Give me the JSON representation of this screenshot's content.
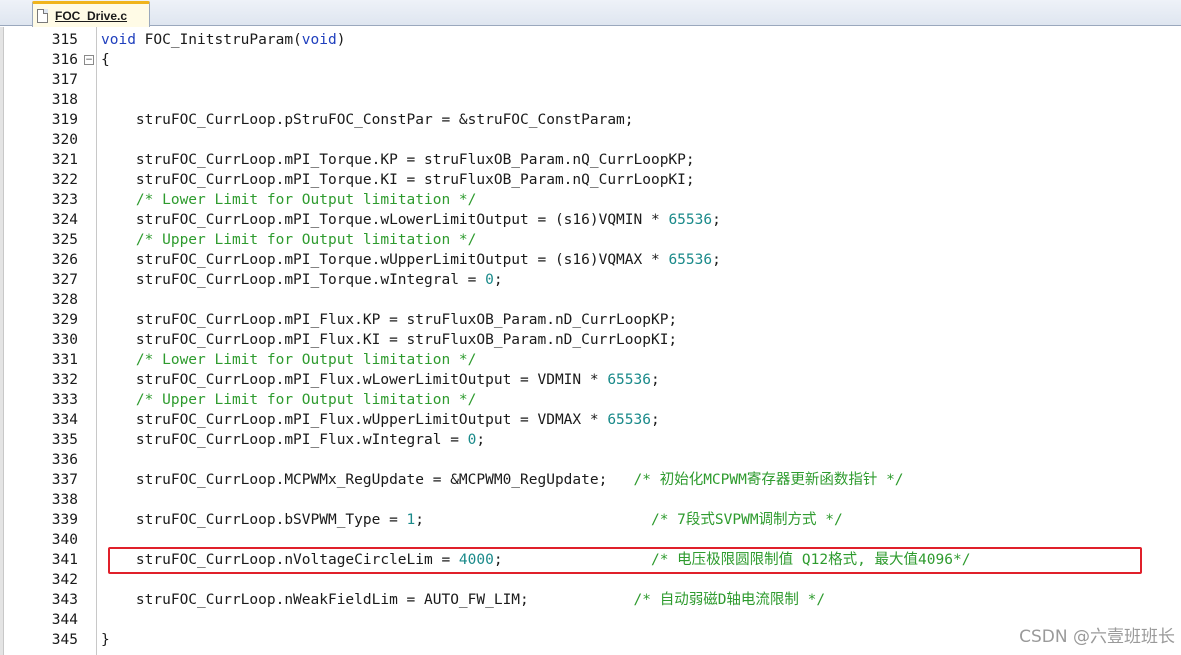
{
  "tab": {
    "label": "FOC_Drive.c",
    "icon": "file-icon"
  },
  "lines": [
    {
      "num": "315",
      "tokens": [
        {
          "t": "void",
          "c": "kw"
        },
        {
          "t": " FOC_InitstruParam("
        },
        {
          "t": "void",
          "c": "kw"
        },
        {
          "t": ")"
        }
      ]
    },
    {
      "num": "316",
      "fold": "−",
      "tokens": [
        {
          "t": "{"
        }
      ]
    },
    {
      "num": "317",
      "tokens": []
    },
    {
      "num": "318",
      "tokens": []
    },
    {
      "num": "319",
      "tokens": [
        {
          "t": "    struFOC_CurrLoop.pStruFOC_ConstPar = &struFOC_ConstParam;"
        }
      ]
    },
    {
      "num": "320",
      "tokens": []
    },
    {
      "num": "321",
      "tokens": [
        {
          "t": "    struFOC_CurrLoop.mPI_Torque.KP = struFluxOB_Param.nQ_CurrLoopKP;"
        }
      ]
    },
    {
      "num": "322",
      "tokens": [
        {
          "t": "    struFOC_CurrLoop.mPI_Torque.KI = struFluxOB_Param.nQ_CurrLoopKI;"
        }
      ]
    },
    {
      "num": "323",
      "tokens": [
        {
          "t": "    "
        },
        {
          "t": "/* Lower Limit for Output limitation */",
          "c": "cm"
        }
      ]
    },
    {
      "num": "324",
      "tokens": [
        {
          "t": "    struFOC_CurrLoop.mPI_Torque.wLowerLimitOutput = (s16)VQMIN * "
        },
        {
          "t": "65536",
          "c": "num"
        },
        {
          "t": ";"
        }
      ]
    },
    {
      "num": "325",
      "tokens": [
        {
          "t": "    "
        },
        {
          "t": "/* Upper Limit for Output limitation */",
          "c": "cm"
        }
      ]
    },
    {
      "num": "326",
      "tokens": [
        {
          "t": "    struFOC_CurrLoop.mPI_Torque.wUpperLimitOutput = (s16)VQMAX * "
        },
        {
          "t": "65536",
          "c": "num"
        },
        {
          "t": ";"
        }
      ]
    },
    {
      "num": "327",
      "tokens": [
        {
          "t": "    struFOC_CurrLoop.mPI_Torque.wIntegral = "
        },
        {
          "t": "0",
          "c": "num"
        },
        {
          "t": ";"
        }
      ]
    },
    {
      "num": "328",
      "tokens": []
    },
    {
      "num": "329",
      "tokens": [
        {
          "t": "    struFOC_CurrLoop.mPI_Flux.KP = struFluxOB_Param.nD_CurrLoopKP;"
        }
      ]
    },
    {
      "num": "330",
      "tokens": [
        {
          "t": "    struFOC_CurrLoop.mPI_Flux.KI = struFluxOB_Param.nD_CurrLoopKI;"
        }
      ]
    },
    {
      "num": "331",
      "tokens": [
        {
          "t": "    "
        },
        {
          "t": "/* Lower Limit for Output limitation */",
          "c": "cm"
        }
      ]
    },
    {
      "num": "332",
      "tokens": [
        {
          "t": "    struFOC_CurrLoop.mPI_Flux.wLowerLimitOutput = VDMIN * "
        },
        {
          "t": "65536",
          "c": "num"
        },
        {
          "t": ";"
        }
      ]
    },
    {
      "num": "333",
      "tokens": [
        {
          "t": "    "
        },
        {
          "t": "/* Upper Limit for Output limitation */",
          "c": "cm"
        }
      ]
    },
    {
      "num": "334",
      "tokens": [
        {
          "t": "    struFOC_CurrLoop.mPI_Flux.wUpperLimitOutput = VDMAX * "
        },
        {
          "t": "65536",
          "c": "num"
        },
        {
          "t": ";"
        }
      ]
    },
    {
      "num": "335",
      "tokens": [
        {
          "t": "    struFOC_CurrLoop.mPI_Flux.wIntegral = "
        },
        {
          "t": "0",
          "c": "num"
        },
        {
          "t": ";"
        }
      ]
    },
    {
      "num": "336",
      "tokens": []
    },
    {
      "num": "337",
      "tokens": [
        {
          "t": "    struFOC_CurrLoop.MCPWMx_RegUpdate = &MCPWM0_RegUpdate;   "
        },
        {
          "t": "/* 初始化MCPWM寄存器更新函数指针 */",
          "c": "cm"
        }
      ]
    },
    {
      "num": "338",
      "tokens": []
    },
    {
      "num": "339",
      "tokens": [
        {
          "t": "    struFOC_CurrLoop.bSVPWM_Type = "
        },
        {
          "t": "1",
          "c": "num"
        },
        {
          "t": ";                          "
        },
        {
          "t": "/* 7段式SVPWM调制方式 */",
          "c": "cm"
        }
      ]
    },
    {
      "num": "340",
      "tokens": []
    },
    {
      "num": "341",
      "tokens": [
        {
          "t": "    struFOC_CurrLoop.nVoltageCircleLim = "
        },
        {
          "t": "4000",
          "c": "num"
        },
        {
          "t": ";                 "
        },
        {
          "t": "/* 电压极限圆限制值 Q12格式, 最大值4096*/",
          "c": "cm"
        }
      ]
    },
    {
      "num": "342",
      "tokens": []
    },
    {
      "num": "343",
      "tokens": [
        {
          "t": "    struFOC_CurrLoop.nWeakFieldLim = AUTO_FW_LIM;            "
        },
        {
          "t": "/* 自动弱磁D轴电流限制 */",
          "c": "cm"
        }
      ]
    },
    {
      "num": "344",
      "tokens": []
    },
    {
      "num": "345",
      "tokens": [
        {
          "t": "}"
        }
      ]
    }
  ],
  "watermark": "CSDN @六壹班班长",
  "colors": {
    "keyword": "#1f3fbd",
    "comment": "#2e9b2e",
    "number": "#1a8a8a",
    "highlight_box": "#e0202a"
  }
}
